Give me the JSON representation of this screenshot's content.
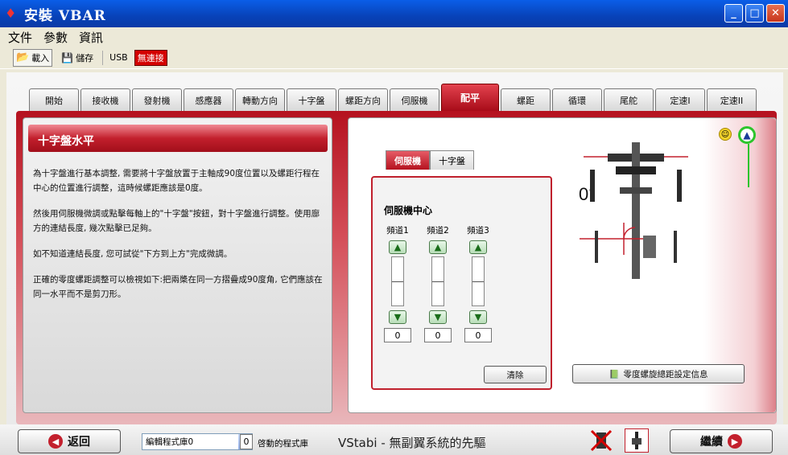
{
  "window": {
    "title": "安裝 VBAR",
    "minimize": "_",
    "maximize": "□",
    "close": "✕"
  },
  "menu": [
    "文件",
    "參數",
    "資訊"
  ],
  "toolbar": {
    "load": "載入",
    "save": "儲存",
    "usb": "USB",
    "status": "無連接"
  },
  "tabs": [
    "開始",
    "接收機",
    "發射機",
    "感應器",
    "轉動方向",
    "十字盤",
    "螺距方向",
    "伺服機",
    "配平",
    "螺距",
    "循環",
    "尾舵",
    "定速I",
    "定速II"
  ],
  "active_tab": "配平",
  "left": {
    "header": "十字盤水平",
    "paragraphs": [
      "為十字盤進行基本調整, 需要將十字盤放置于主軸成90度位置以及螺距行程在中心的位置進行調整，這時候螺距應該是0度。",
      "然後用伺服機微調或點擊每軸上的\"十字盤\"按鈕，對十字盤進行調整。使用廍方的連結長度, 幾次點擊已足夠。",
      "如不知道連結長度, 您可試從\"下方到上方\"完成微調。",
      "正確的零度螺距調整可以檢視如下:把兩槳在同一方摺疊成90度角, 它們應該在同一水平而不是剪刀形。"
    ]
  },
  "right": {
    "inner_tabs": [
      "伺服機",
      "十字盤"
    ],
    "servo_title": "伺服機中心",
    "channels": [
      {
        "label": "頻道1",
        "value": "0"
      },
      {
        "label": "頻道2",
        "value": "0"
      },
      {
        "label": "頻道3",
        "value": "0"
      }
    ],
    "clear_button": "清除",
    "info_button": "零度螺旋總距設定信息",
    "angle": "0°"
  },
  "bottom": {
    "back": "返回",
    "continue": "繼續",
    "library_select": "編輯程式庫0",
    "counter": "0",
    "active_lib_label": "啓動的程式庫",
    "slogan": "VStabi - 無副翼系統的先驅"
  }
}
